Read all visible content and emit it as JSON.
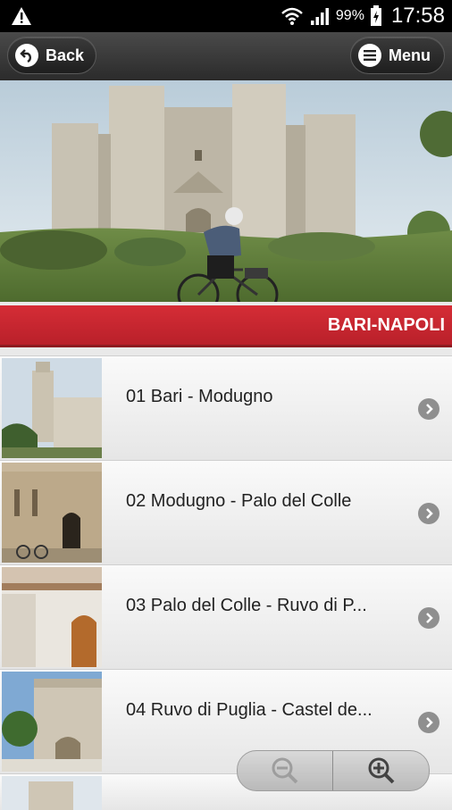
{
  "status": {
    "battery_pct": "99%",
    "time": "17:58",
    "icons": [
      "warning-icon",
      "wifi-icon",
      "signal-icon",
      "battery-icon"
    ]
  },
  "header": {
    "back_label": "Back",
    "menu_label": "Menu"
  },
  "section": {
    "title": "BARI-NAPOLI"
  },
  "routes": [
    {
      "label": "01 Bari - Modugno"
    },
    {
      "label": "02 Modugno - Palo del Colle"
    },
    {
      "label": "03 Palo del Colle - Ruvo di P..."
    },
    {
      "label": "04 Ruvo di Puglia - Castel de..."
    }
  ],
  "zoom": {
    "icons": [
      "zoom-out-icon",
      "zoom-in-icon"
    ]
  },
  "colors": {
    "accent_red": "#c4252e",
    "header_dark": "#2b2b2b"
  }
}
